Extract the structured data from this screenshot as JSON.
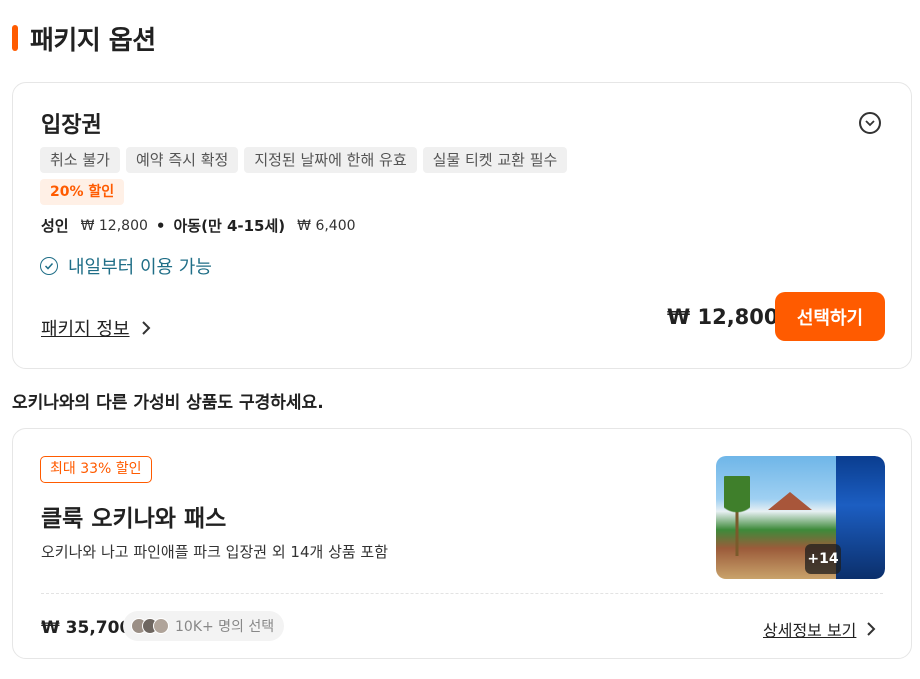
{
  "section": {
    "title": "패키지 옵션",
    "accent_color": "#ff5b00"
  },
  "package": {
    "name": "입장권",
    "collapse_icon": "chevron-down-circle-icon",
    "tags": [
      "취소 불가",
      "예약 즉시 확정",
      "지정된 날짜에 한해 유효",
      "실물 티켓 교환 필수"
    ],
    "discount_tag": "20% 할인",
    "adult_label": "성인",
    "adult_price": "₩ 12,800",
    "separator": "•",
    "child_label": "아동(만 4-15세)",
    "child_price": "₩ 6,400",
    "availability": "내일부터 이용 가능",
    "info_link": "패키지 정보",
    "total_price": "₩ 12,800",
    "select_button": "선택하기"
  },
  "promo": {
    "heading": "오키나와의 다른 가성비 상품도 구경하세요.",
    "badge": "최대 33% 할인",
    "title": "클룩 오키나와 패스",
    "description": "오키나와 나고 파인애플 파크 입장권 외 14개 상품 포함",
    "image_more": "+14",
    "price": "₩ 35,700",
    "social_proof": "10K+ 명의 선택",
    "detail_link": "상세정보 보기"
  }
}
